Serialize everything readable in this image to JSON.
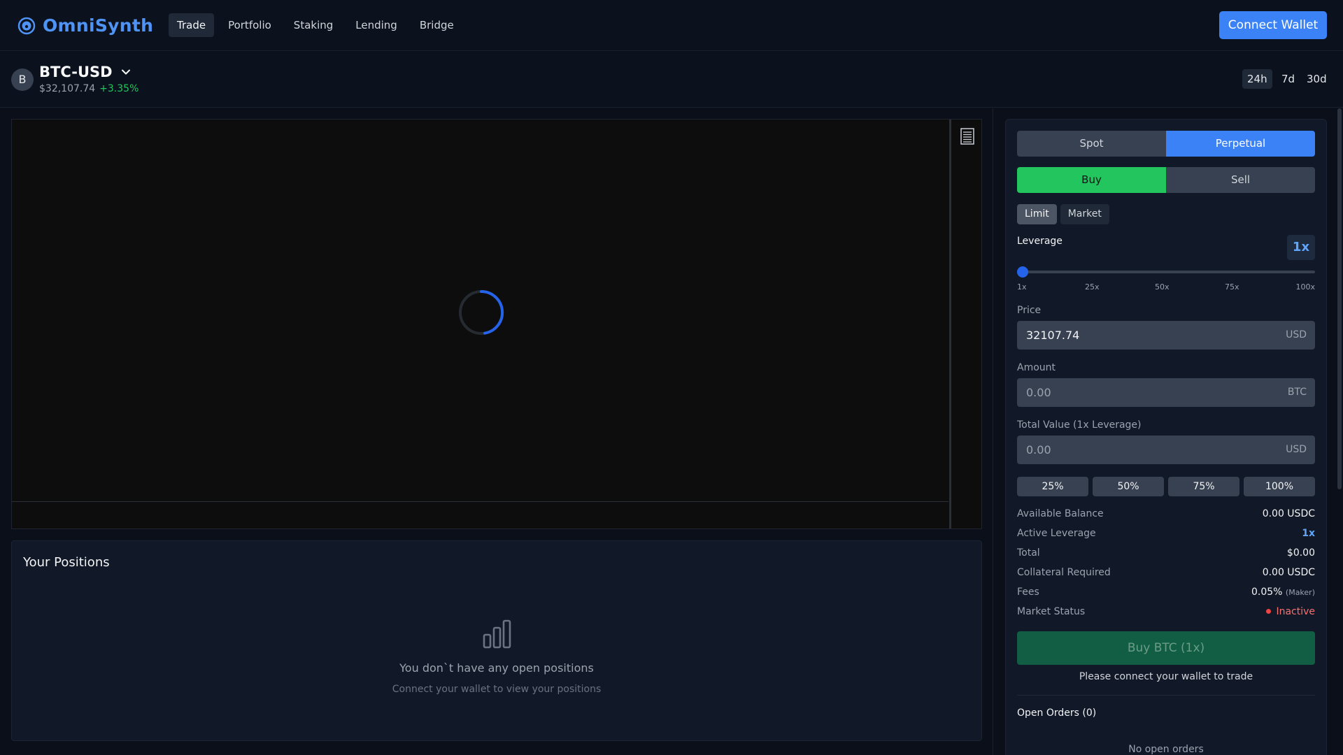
{
  "app": {
    "name": "OmniSynth"
  },
  "nav": {
    "items": [
      {
        "label": "Trade",
        "active": true
      },
      {
        "label": "Portfolio",
        "active": false
      },
      {
        "label": "Staking",
        "active": false
      },
      {
        "label": "Lending",
        "active": false
      },
      {
        "label": "Bridge",
        "active": false
      }
    ],
    "connect_wallet": "Connect Wallet"
  },
  "market": {
    "avatar_letter": "B",
    "pair": "BTC-USD",
    "price": "$32,107.74",
    "change": "+3.35%",
    "timeframes": [
      "24h",
      "7d",
      "30d"
    ],
    "active_timeframe": "24h"
  },
  "chart": {
    "state": "loading",
    "icons": [
      "ruled-list-icon",
      "loading-spinner-icon"
    ]
  },
  "positions": {
    "title": "Your Positions",
    "empty_title": "You don`t have any open positions",
    "empty_sub": "Connect your wallet to view your positions",
    "icon": "bar-chart-icon"
  },
  "order": {
    "market_types": [
      "Spot",
      "Perpetual"
    ],
    "active_market_type": "Perpetual",
    "sides": [
      "Buy",
      "Sell"
    ],
    "active_side": "Buy",
    "order_types": [
      "Limit",
      "Market"
    ],
    "active_order_type": "Limit",
    "leverage_label": "Leverage",
    "leverage_value": "1x",
    "leverage_ticks": [
      "1x",
      "25x",
      "50x",
      "75x",
      "100x"
    ],
    "leverage_slider_value": 1,
    "price_label": "Price",
    "price_value": "32107.74",
    "price_unit": "USD",
    "amount_label": "Amount",
    "amount_placeholder": "0.00",
    "amount_unit": "BTC",
    "total_label": "Total Value (1x Leverage)",
    "total_placeholder": "0.00",
    "total_unit": "USD",
    "percent_buttons": [
      "25%",
      "50%",
      "75%",
      "100%"
    ],
    "info": {
      "available_balance_label": "Available Balance",
      "available_balance": "0.00 USDC",
      "active_leverage_label": "Active Leverage",
      "active_leverage": "1x",
      "total_label": "Total",
      "total": "$0.00",
      "collateral_label": "Collateral Required",
      "collateral": "0.00 USDC",
      "fees_label": "Fees",
      "fees": "0.05%",
      "fees_note": "(Maker)",
      "market_status_label": "Market Status",
      "market_status": "Inactive"
    },
    "submit_label": "Buy BTC (1x)",
    "connect_note": "Please connect your wallet to trade",
    "open_orders_title": "Open Orders (0)",
    "open_orders_empty": "No open orders"
  },
  "colors": {
    "accent": "#3b82f6",
    "buy": "#22c55e",
    "positive": "#22c55e",
    "inactive": "#f87171",
    "background": "#0a0f1a"
  }
}
